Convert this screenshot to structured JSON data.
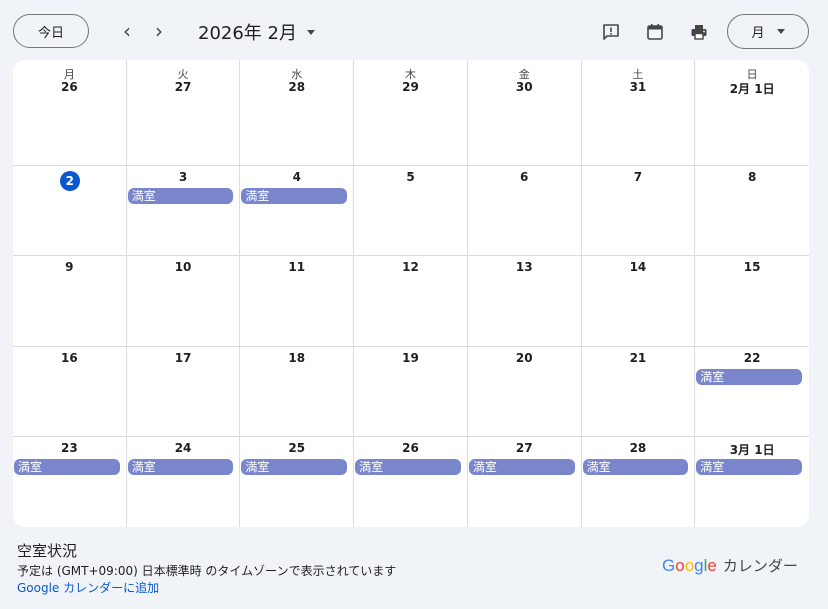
{
  "toolbar": {
    "today_label": "今日",
    "prev_label": "‹",
    "next_label": "›",
    "month_title": "2026年 2月",
    "view_label": "月"
  },
  "icons": {
    "feedback": "feedback-icon",
    "calendar": "calendar-icon",
    "print": "print-icon"
  },
  "weekdays": [
    "月",
    "火",
    "水",
    "木",
    "金",
    "土",
    "日"
  ],
  "weeks": [
    [
      {
        "date": "26",
        "events": []
      },
      {
        "date": "27",
        "events": []
      },
      {
        "date": "28",
        "events": []
      },
      {
        "date": "29",
        "events": []
      },
      {
        "date": "30",
        "events": []
      },
      {
        "date": "31",
        "events": []
      },
      {
        "date": "2月 1日",
        "events": []
      }
    ],
    [
      {
        "date": "2",
        "today": true,
        "events": []
      },
      {
        "date": "3",
        "events": [
          "満室"
        ]
      },
      {
        "date": "4",
        "events": [
          "満室"
        ]
      },
      {
        "date": "5",
        "events": []
      },
      {
        "date": "6",
        "events": []
      },
      {
        "date": "7",
        "events": []
      },
      {
        "date": "8",
        "events": []
      }
    ],
    [
      {
        "date": "9",
        "events": []
      },
      {
        "date": "10",
        "events": []
      },
      {
        "date": "11",
        "events": []
      },
      {
        "date": "12",
        "events": []
      },
      {
        "date": "13",
        "events": []
      },
      {
        "date": "14",
        "events": []
      },
      {
        "date": "15",
        "events": []
      }
    ],
    [
      {
        "date": "16",
        "events": []
      },
      {
        "date": "17",
        "events": []
      },
      {
        "date": "18",
        "events": []
      },
      {
        "date": "19",
        "events": []
      },
      {
        "date": "20",
        "events": []
      },
      {
        "date": "21",
        "events": []
      },
      {
        "date": "22",
        "events": [
          "満室"
        ]
      }
    ],
    [
      {
        "date": "23",
        "events": [
          "満室"
        ]
      },
      {
        "date": "24",
        "events": [
          "満室"
        ]
      },
      {
        "date": "25",
        "events": [
          "満室"
        ]
      },
      {
        "date": "26",
        "events": [
          "満室"
        ]
      },
      {
        "date": "27",
        "events": [
          "満室"
        ]
      },
      {
        "date": "28",
        "events": [
          "満室"
        ]
      },
      {
        "date": "3月 1日",
        "events": [
          "満室"
        ]
      }
    ]
  ],
  "footer": {
    "title": "空室状況",
    "timezone_note": "予定は (GMT+09:00) 日本標準時 のタイムゾーンで表示されています",
    "add_link": "Google カレンダーに追加",
    "brand_logo": [
      "G",
      "o",
      "o",
      "g",
      "l",
      "e"
    ],
    "brand_text": "カレンダー"
  },
  "colors": {
    "event": "#7986cb",
    "today": "#0b57d0",
    "link": "#0b57d0",
    "brand_letters": [
      "#4285f4",
      "#ea4335",
      "#fbbc05",
      "#4285f4",
      "#34a853",
      "#ea4335"
    ]
  }
}
